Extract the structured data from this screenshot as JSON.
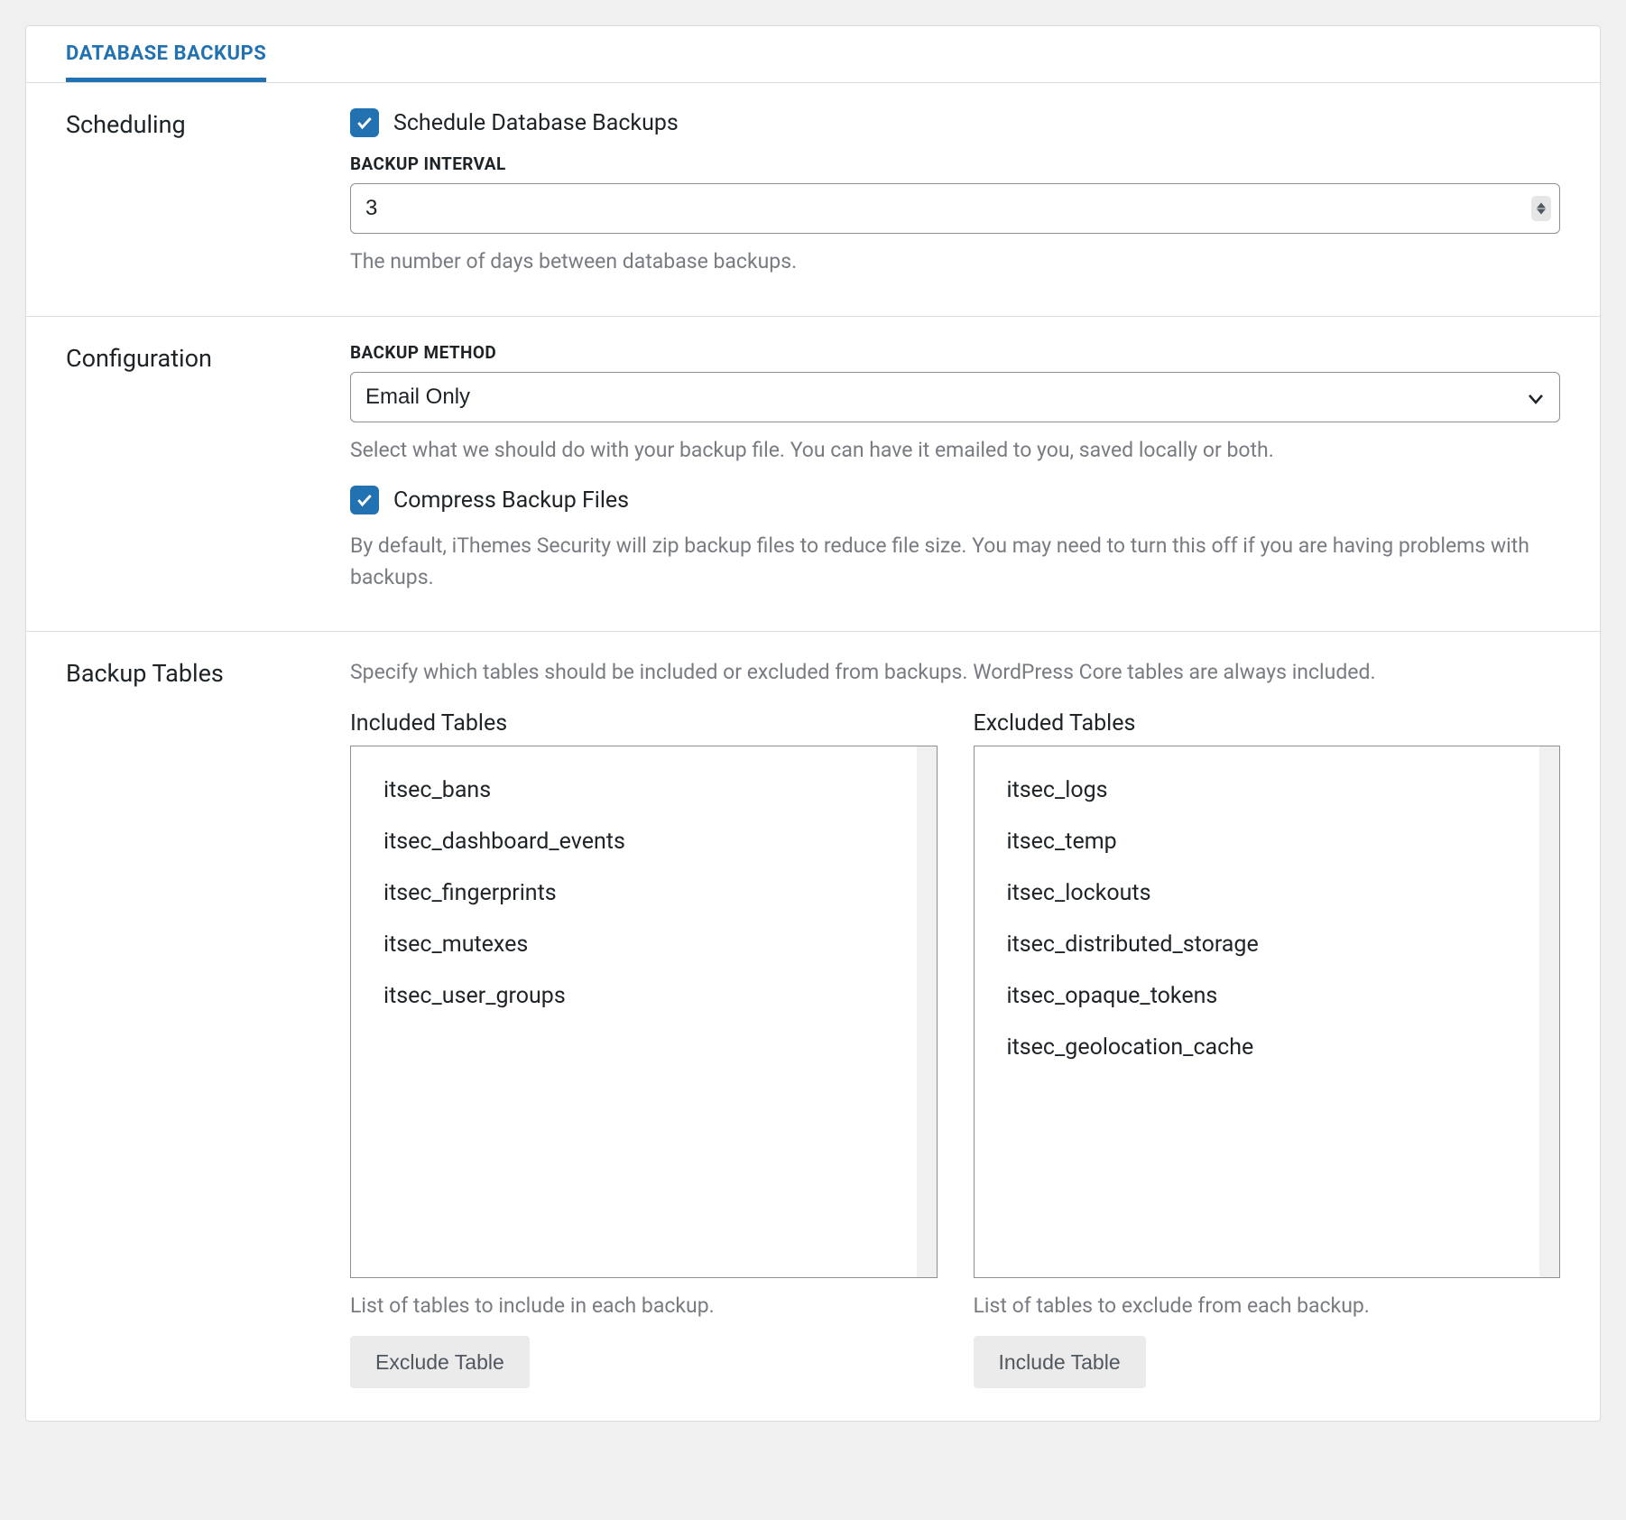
{
  "tab": {
    "label": "DATABASE BACKUPS"
  },
  "scheduling": {
    "title": "Scheduling",
    "checkbox_label": "Schedule Database Backups",
    "interval_label": "BACKUP INTERVAL",
    "interval_value": "3",
    "interval_help": "The number of days between database backups."
  },
  "configuration": {
    "title": "Configuration",
    "method_label": "BACKUP METHOD",
    "method_value": "Email Only",
    "method_help": "Select what we should do with your backup file. You can have it emailed to you, saved locally or both.",
    "compress_label": "Compress Backup Files",
    "compress_help": "By default, iThemes Security will zip backup files to reduce file size. You may need to turn this off if you are having problems with backups."
  },
  "backup_tables": {
    "title": "Backup Tables",
    "intro": "Specify which tables should be included or excluded from backups. WordPress Core tables are always included.",
    "included": {
      "heading": "Included Tables",
      "items": [
        "itsec_bans",
        "itsec_dashboard_events",
        "itsec_fingerprints",
        "itsec_mutexes",
        "itsec_user_groups"
      ],
      "help": "List of tables to include in each backup.",
      "button": "Exclude Table"
    },
    "excluded": {
      "heading": "Excluded Tables",
      "items": [
        "itsec_logs",
        "itsec_temp",
        "itsec_lockouts",
        "itsec_distributed_storage",
        "itsec_opaque_tokens",
        "itsec_geolocation_cache"
      ],
      "help": "List of tables to exclude from each backup.",
      "button": "Include Table"
    }
  }
}
